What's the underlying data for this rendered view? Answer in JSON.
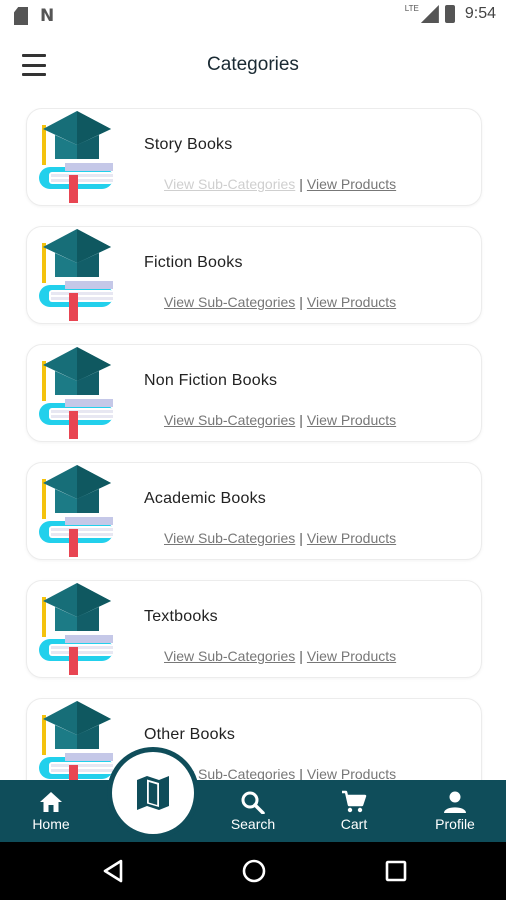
{
  "status_bar": {
    "lte": "LTE",
    "time": "9:54"
  },
  "header": {
    "title": "Categories",
    "menu_icon": "hamburger-menu-icon"
  },
  "categories": [
    {
      "title": "Story Books",
      "sub_link": "View Sub-Categories",
      "products_link": "View Products",
      "separator": "|"
    },
    {
      "title": "Fiction Books",
      "sub_link": "View Sub-Categories",
      "products_link": "View Products",
      "separator": "|"
    },
    {
      "title": "Non Fiction Books",
      "sub_link": "View Sub-Categories",
      "products_link": "View Products",
      "separator": "|"
    },
    {
      "title": "Academic Books",
      "sub_link": "View Sub-Categories",
      "products_link": "View Products",
      "separator": "|"
    },
    {
      "title": "Textbooks",
      "sub_link": "View Sub-Categories",
      "products_link": "View Products",
      "separator": "|"
    },
    {
      "title": "Other Books",
      "sub_link": "View Sub-Categories",
      "products_link": "View Products",
      "separator": "|"
    }
  ],
  "bottom_nav": {
    "home": "Home",
    "search": "Search",
    "cart": "Cart",
    "profile": "Profile",
    "center_icon": "map-icon"
  },
  "colors": {
    "nav_background": "#0f4d5a",
    "cap_teal": "#176e78",
    "book_cyan": "#22d0ec",
    "bookmark_red": "#e84552"
  }
}
